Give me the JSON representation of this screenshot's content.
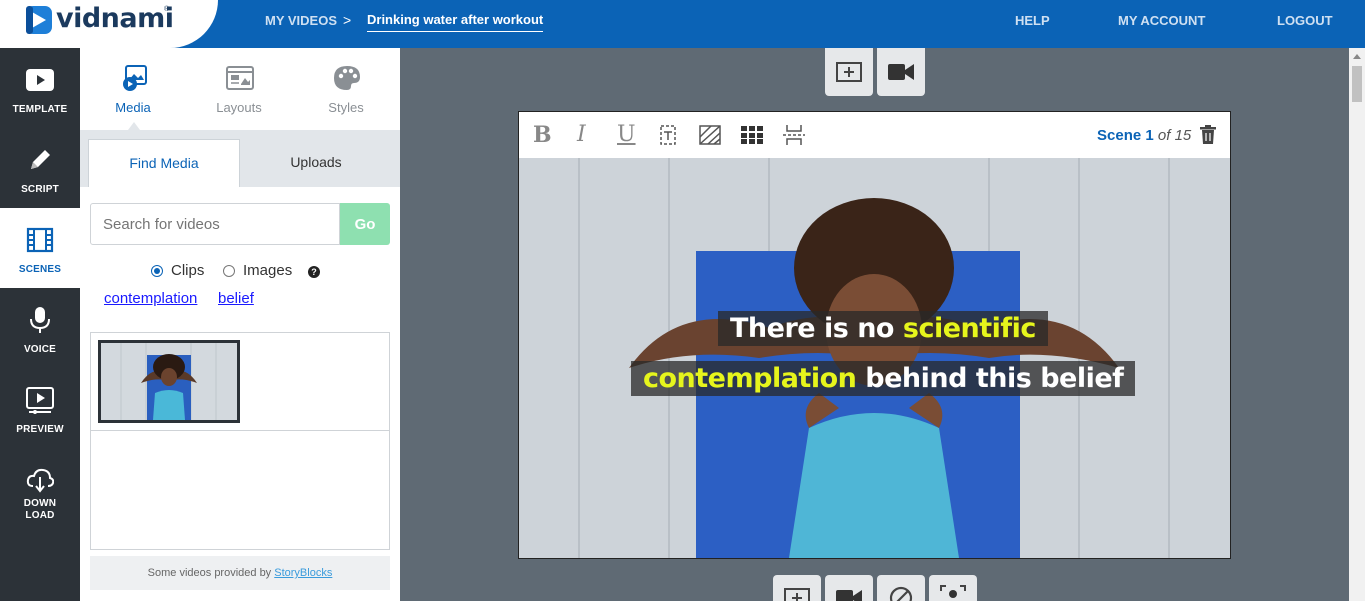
{
  "app": {
    "brand": "vidnami",
    "brand_mark": "®"
  },
  "header": {
    "breadcrumb_root": "MY VIDEOS",
    "breadcrumb_separator": ">",
    "project_title": "Drinking water after workout",
    "nav": {
      "help": "HELP",
      "account": "MY ACCOUNT",
      "logout": "LOGOUT"
    }
  },
  "rail": {
    "items": [
      {
        "label": "TEMPLATE",
        "icon": "play-box-icon"
      },
      {
        "label": "SCRIPT",
        "icon": "pencil-icon"
      },
      {
        "label": "SCENES",
        "icon": "film-icon",
        "active": true
      },
      {
        "label": "VOICE",
        "icon": "microphone-icon"
      },
      {
        "label": "PREVIEW",
        "icon": "preview-icon"
      },
      {
        "label_line1": "DOWN",
        "label_line2": "LOAD",
        "icon": "cloud-download-icon"
      }
    ]
  },
  "panel": {
    "tabs": {
      "media": "Media",
      "layouts": "Layouts",
      "styles": "Styles"
    },
    "subtabs": {
      "find": "Find Media",
      "uploads": "Uploads"
    },
    "search": {
      "placeholder": "Search for videos",
      "go": "Go"
    },
    "filter": {
      "clips": "Clips",
      "images": "Images",
      "selected": "Clips"
    },
    "keywords": [
      "contemplation",
      "belief"
    ],
    "credit_prefix": "Some videos provided by ",
    "credit_link": "StoryBlocks"
  },
  "scene": {
    "label": "Scene",
    "number": "1",
    "of_text": "of 15",
    "caption_line1": {
      "plain": "There is no ",
      "highlight": "scientific"
    },
    "caption_line2": {
      "highlight": "contemplation",
      "plain": " behind this belief"
    }
  },
  "colors": {
    "primary": "#0b63b6",
    "rail_bg": "#2c3238",
    "go_button": "#8ee0b0",
    "caption_highlight": "#e6f51c",
    "workspace": "#5f6a74"
  }
}
